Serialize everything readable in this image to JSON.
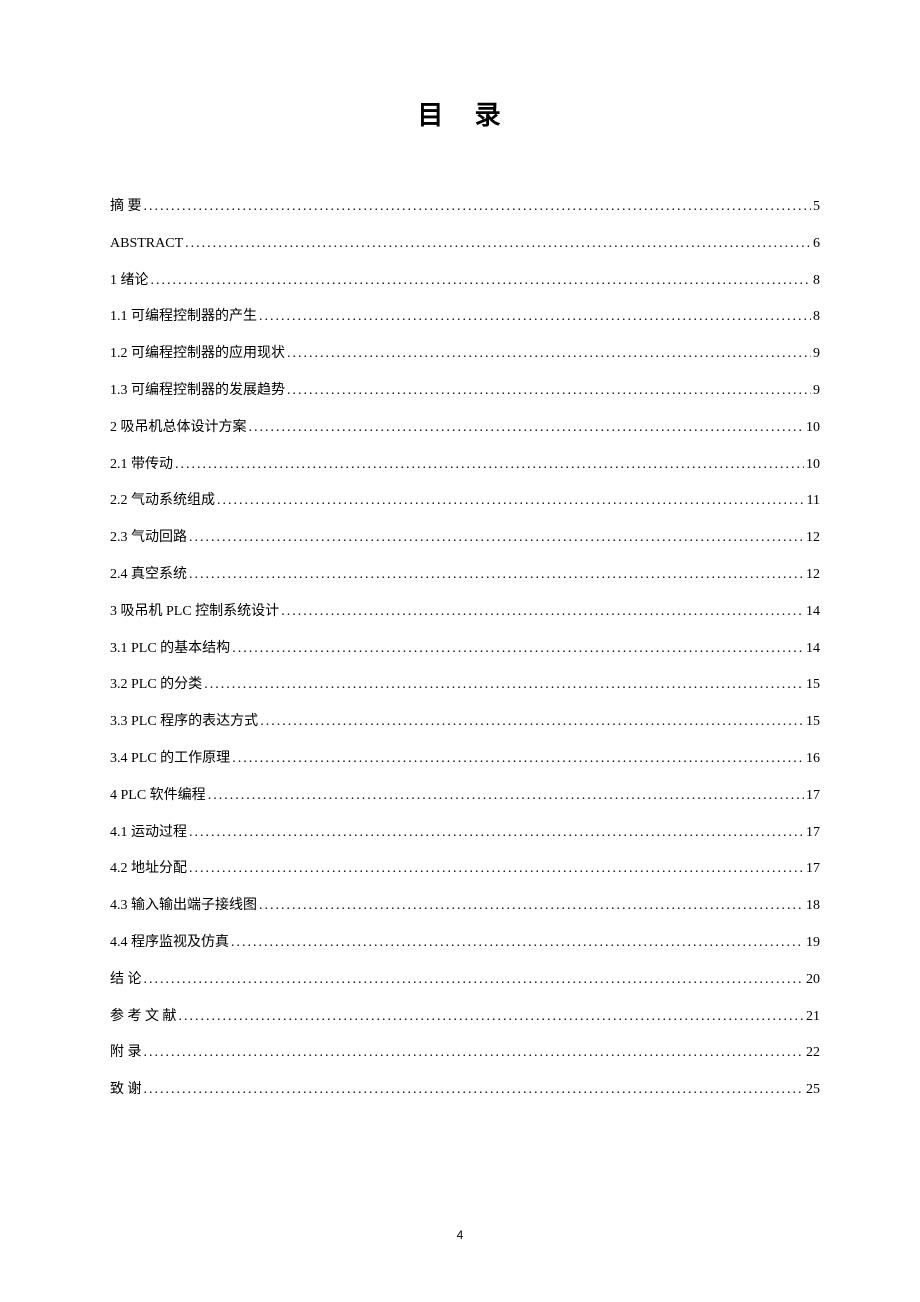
{
  "title": "目 录",
  "entries": [
    {
      "label": "摘    要",
      "page": "5",
      "spaced": false
    },
    {
      "label": "ABSTRACT",
      "page": "6",
      "spaced": false
    },
    {
      "label": "1 绪论",
      "page": "8",
      "spaced": false
    },
    {
      "label": "1.1 可编程控制器的产生",
      "page": "8",
      "spaced": false
    },
    {
      "label": "1.2 可编程控制器的应用现状",
      "page": "9",
      "spaced": false
    },
    {
      "label": "1.3 可编程控制器的发展趋势",
      "page": "9",
      "spaced": false
    },
    {
      "label": "2 吸吊机总体设计方案",
      "page": "10",
      "spaced": false
    },
    {
      "label": "2.1 带传动",
      "page": "10",
      "spaced": false
    },
    {
      "label": "2.2 气动系统组成",
      "page": "11",
      "spaced": false
    },
    {
      "label": "2.3 气动回路",
      "page": "12",
      "spaced": false
    },
    {
      "label": "2.4 真空系统",
      "page": "12",
      "spaced": false
    },
    {
      "label": "3 吸吊机 PLC 控制系统设计",
      "page": "14",
      "spaced": false
    },
    {
      "label": "3.1 PLC 的基本结构",
      "page": "14",
      "spaced": false
    },
    {
      "label": "3.2 PLC 的分类",
      "page": "15",
      "spaced": false
    },
    {
      "label": "3.3 PLC 程序的表达方式",
      "page": "15",
      "spaced": false
    },
    {
      "label": "3.4 PLC 的工作原理",
      "page": "16",
      "spaced": false
    },
    {
      "label": "4 PLC 软件编程",
      "page": "17",
      "spaced": false
    },
    {
      "label": "4.1 运动过程",
      "page": "17",
      "spaced": false
    },
    {
      "label": "4.2 地址分配",
      "page": "17",
      "spaced": false
    },
    {
      "label": "4.3 输入输出端子接线图",
      "page": "18",
      "spaced": false
    },
    {
      "label": "4.4 程序监视及仿真",
      "page": "19",
      "spaced": false
    },
    {
      "label": "结    论",
      "page": "20",
      "spaced": false
    },
    {
      "label": "参 考 文 献",
      "page": "21",
      "spaced": false
    },
    {
      "label": "附    录",
      "page": "22",
      "spaced": false
    },
    {
      "label": "致    谢",
      "page": "25",
      "spaced": false
    }
  ],
  "pageNumber": "4"
}
